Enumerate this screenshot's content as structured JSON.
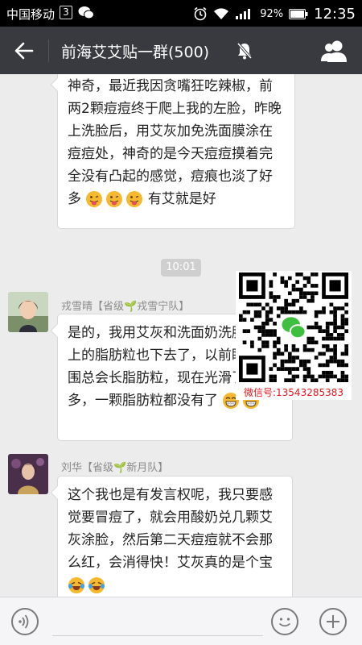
{
  "status_bar": {
    "carrier": "中国移动",
    "notification_count": "3",
    "battery_percent": "92%",
    "time": "12:35"
  },
  "header": {
    "title": "前海艾艾贴一群(500)",
    "back_icon": "arrow-left-icon",
    "mute_icon": "bell-off-icon",
    "members_icon": "group-icon"
  },
  "messages": [
    {
      "text": "神奇，最近我因贪嘴狂吃辣椒，前两2颗痘痘终于爬上我的左脸，昨晚上洗脸后，用艾灰加免洗面膜涂在痘痘处，神奇的是今天痘痘摸着完全没有凸起的感觉，痘痕也淡了好",
      "tail": "多",
      "tail_after": "有艾就是好"
    },
    {
      "sender": "戎雪晴【省级",
      "sender_sprout": "🌱",
      "sender_team": "戎雪宁队】",
      "text": "是的，我用艾灰和洗面奶洗脸，脸上的脂肪粒也下去了，以前眼角周围总会长脂肪粒，现在光滑了许多，一颗脂肪粒都没有了"
    },
    {
      "sender": "刘华【省级",
      "sender_sprout": "🌱",
      "sender_team": "新月队】",
      "text": "这个我也是有发言权呢，我只要感觉要冒痘了，就会用酸奶兑几颗艾灰涂脸，然后第二天痘痘就不会那么红，会消得快！艾灰真的是个宝"
    }
  ],
  "timestamp": "10:01",
  "qr": {
    "caption": "微信号:13543285383"
  },
  "colors": {
    "titlebar": "#393a3f",
    "chat_bg": "#ececec",
    "qr_caption": "#e0191f"
  }
}
